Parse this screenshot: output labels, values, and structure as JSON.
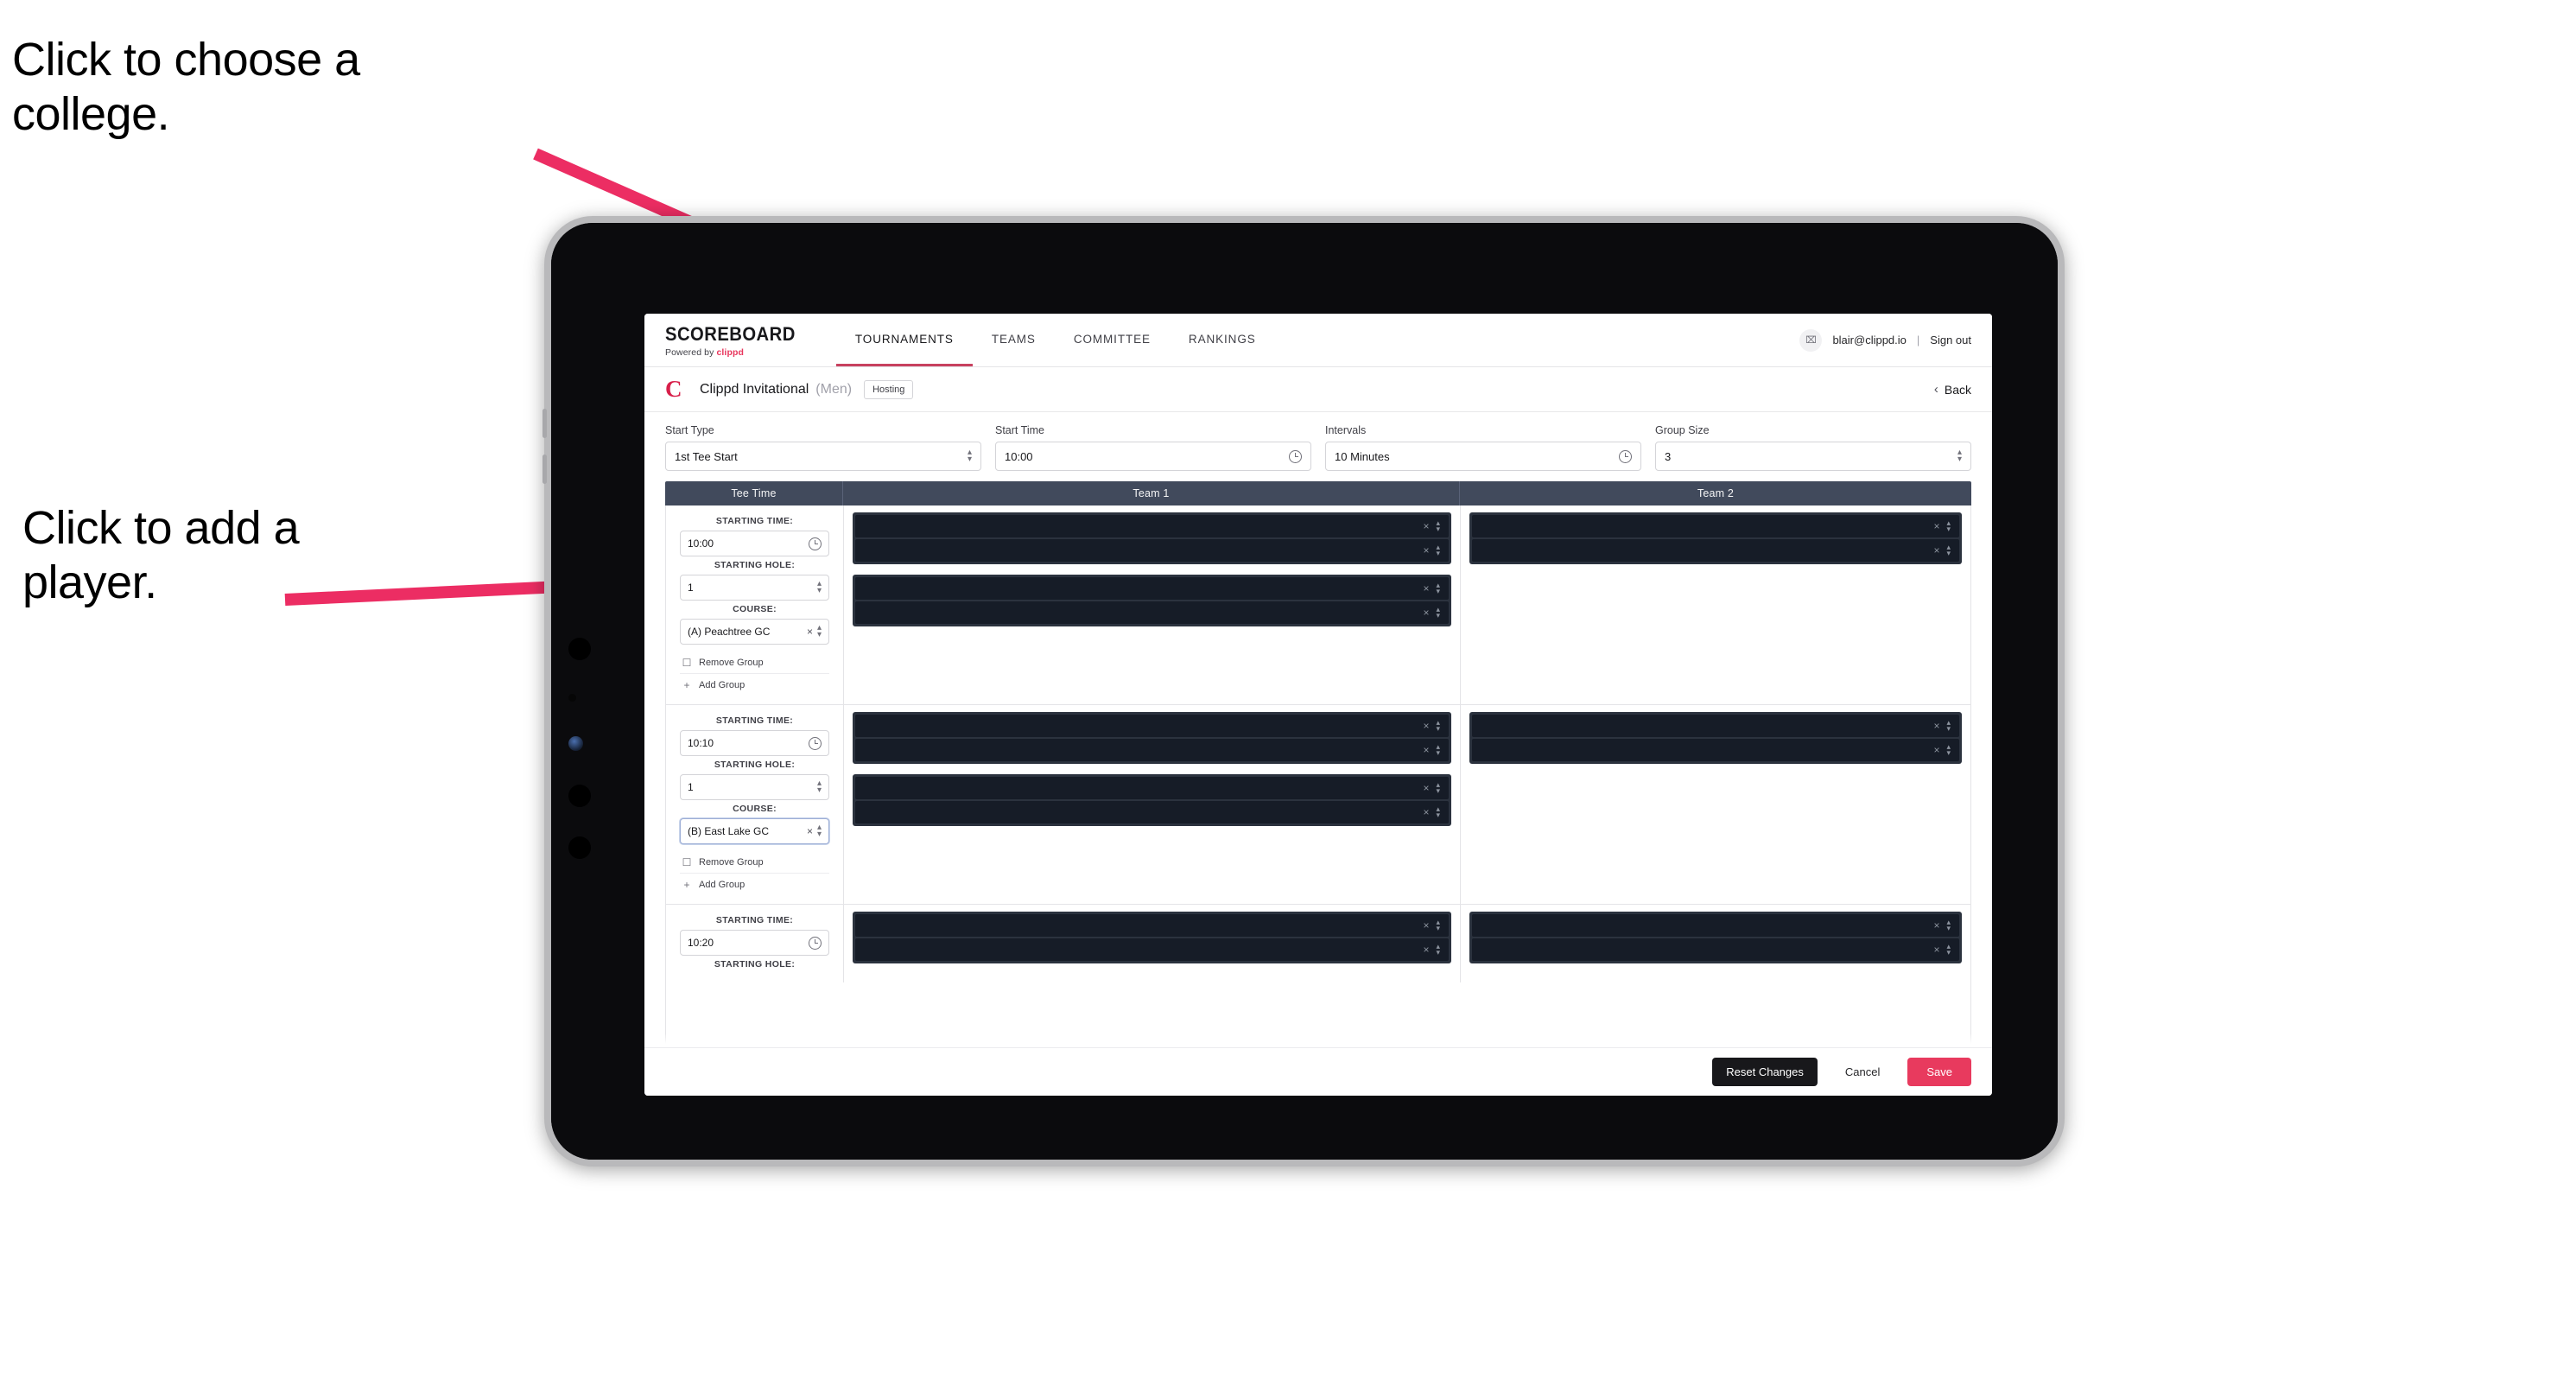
{
  "annotations": {
    "choose_college": "Click to choose a college.",
    "add_player": "Click to add a player."
  },
  "nav": {
    "brand_name": "SCOREBOARD",
    "brand_sub_prefix": "Powered by ",
    "brand_sub_highlight": "clippd",
    "tabs": [
      {
        "label": "TOURNAMENTS",
        "active": true
      },
      {
        "label": "TEAMS",
        "active": false
      },
      {
        "label": "COMMITTEE",
        "active": false
      },
      {
        "label": "RANKINGS",
        "active": false
      }
    ],
    "avatar_glyph": "⌧",
    "email": "blair@clippd.io",
    "separator": "|",
    "sign_out": "Sign out"
  },
  "tournament_bar": {
    "logo_letter": "C",
    "name": "Clippd Invitational",
    "gender": "(Men)",
    "badge": "Hosting",
    "back_chevron": "‹",
    "back_label": "Back"
  },
  "settings": {
    "start_type": {
      "label": "Start Type",
      "value": "1st Tee Start"
    },
    "start_time": {
      "label": "Start Time",
      "value": "10:00"
    },
    "intervals": {
      "label": "Intervals",
      "value": "10 Minutes"
    },
    "group_size": {
      "label": "Group Size",
      "value": "3"
    }
  },
  "table": {
    "headers": {
      "tee_time": "Tee Time",
      "team1": "Team 1",
      "team2": "Team 2"
    },
    "labels": {
      "starting_time": "STARTING TIME:",
      "starting_hole": "STARTING HOLE:",
      "course": "COURSE:",
      "remove_group": "Remove Group",
      "add_group": "Add Group",
      "trash_icon": "☐",
      "plus_icon": "+",
      "clear_icon": "×"
    },
    "groups": [
      {
        "starting_time": "10:00",
        "starting_hole": "1",
        "course": "(A) Peachtree GC",
        "course_focused": false,
        "team1_blocks": [
          {
            "rows": 2,
            "redacted": true
          },
          {
            "rows": 2,
            "redacted": true
          }
        ],
        "team2_blocks": [
          {
            "rows": 2,
            "redacted": true
          }
        ]
      },
      {
        "starting_time": "10:10",
        "starting_hole": "1",
        "course": "(B) East Lake GC",
        "course_focused": true,
        "team1_blocks": [
          {
            "rows": 2,
            "redacted": true
          },
          {
            "rows": 2,
            "redacted": true
          }
        ],
        "team2_blocks": [
          {
            "rows": 2,
            "redacted": true
          }
        ]
      },
      {
        "starting_time": "10:20",
        "starting_hole": "",
        "course": "",
        "course_focused": false,
        "team1_blocks": [
          {
            "rows": 2,
            "redacted": true
          }
        ],
        "team2_blocks": [
          {
            "rows": 2,
            "redacted": true
          }
        ]
      }
    ]
  },
  "footer": {
    "reset": "Reset Changes",
    "cancel": "Cancel",
    "save": "Save"
  },
  "colors": {
    "accent_pink": "#e83a5e",
    "brand_red": "#d81f4a",
    "table_header": "#414a5c",
    "redact_dark": "#161c27",
    "annotation_arrow": "#ec2d63"
  }
}
